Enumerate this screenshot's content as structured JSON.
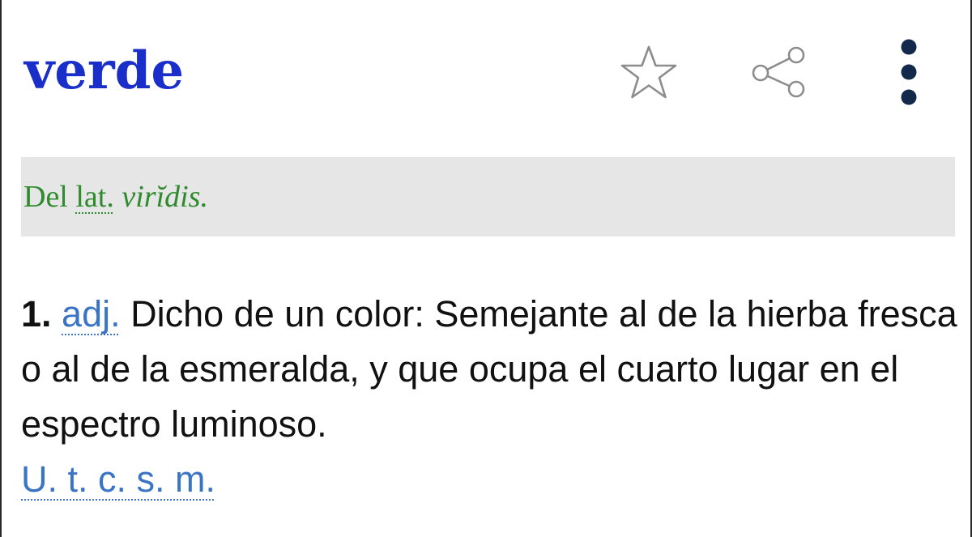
{
  "entry": {
    "headword": "verde",
    "headword_color": "#1a2ec9"
  },
  "toolbar": {
    "favorite_icon": "star-outline-icon",
    "share_icon": "share-icon",
    "more_icon": "more-vertical-icon"
  },
  "etymology": {
    "prefix": "Del",
    "abbr": "lat.",
    "word": "virĭdis.",
    "color": "#2e8b2e",
    "background": "#e6e6e6"
  },
  "definitions": [
    {
      "number": "1.",
      "pos": "adj.",
      "text": "Dicho de un color: Semejante al de la hierba fresca o al de la esmeralda, y que ocupa el cuarto lugar en el espectro luminoso.",
      "usage": "U. t. c. s. m."
    }
  ],
  "link_color": "#3a74c4"
}
